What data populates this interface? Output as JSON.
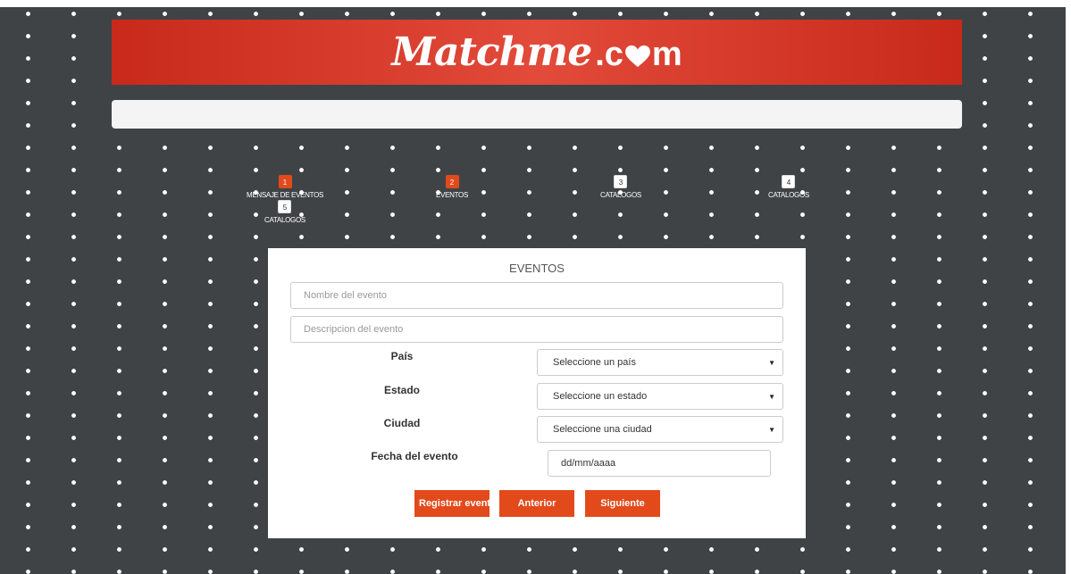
{
  "brand": {
    "logo_script": "Matchme",
    "logo_dot": ".",
    "logo_c": "c",
    "logo_m": "m",
    "color": "#d83a2a"
  },
  "steps": [
    {
      "number": "1",
      "label": "MENSAJE DE EVENTOS",
      "active": true
    },
    {
      "number": "2",
      "label": "EVENTOS",
      "active": true
    },
    {
      "number": "3",
      "label": "CATALOGOS",
      "active": false
    },
    {
      "number": "4",
      "label": "CATALOGOS",
      "active": false
    },
    {
      "number": "5",
      "label": "CATALOGOS",
      "active": false
    }
  ],
  "form": {
    "title": "EVENTOS",
    "event_name_placeholder": "Nombre del evento",
    "event_description_placeholder": "Descripcion del evento",
    "country_label": "País",
    "country_selected": "Seleccione un país",
    "state_label": "Estado",
    "state_selected": "Seleccione un estado",
    "city_label": "Ciudad",
    "city_selected": "Seleccione una ciudad",
    "date_label": "Fecha del evento",
    "date_placeholder": "dd/mm/aaaa",
    "accent_color": "#e24a1c"
  },
  "buttons": {
    "register": "Registrar evento",
    "previous": "Anterior",
    "next": "Siguiente"
  }
}
